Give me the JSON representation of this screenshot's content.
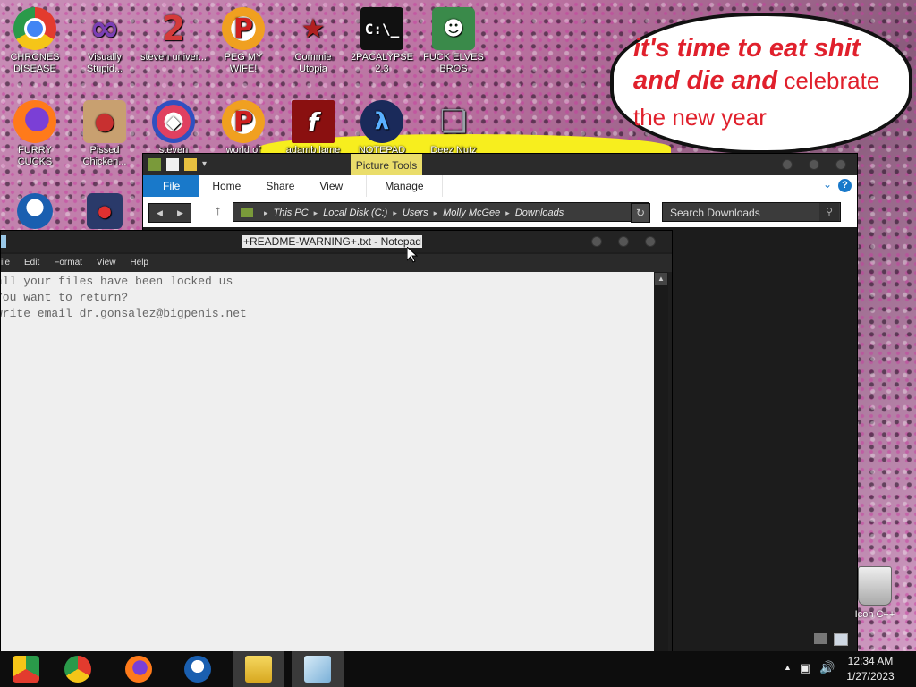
{
  "desktop": {
    "icons": [
      {
        "label": "CHRONES DISEASE",
        "icon": "chrome-icon",
        "color": "#e33b2e"
      },
      {
        "label": "Visually Stupid...",
        "icon": "visual-studio-icon",
        "color": "#7b3fb6"
      },
      {
        "label": "steven univer...",
        "icon": "steven-universe-icon",
        "color": "#d43a3a"
      },
      {
        "label": "PEG MY WIFE!",
        "icon": "peggle-icon",
        "color": "#f0a020"
      },
      {
        "label": "Commie Utopia",
        "icon": "commie-utopia-icon",
        "color": "#b02020"
      },
      {
        "label": "2PACALYPSE 2.3",
        "icon": "terminal-icon",
        "color": "#111111"
      },
      {
        "label": "FUCK ELVES BROS",
        "icon": "elf-icon",
        "color": "#3a8a4a"
      },
      {
        "label": "FURRY CUCKS",
        "icon": "firefox-icon",
        "color": "#ff7a1a"
      },
      {
        "label": "Pissed Chicken...",
        "icon": "angry-birds-seasons-icon",
        "color": "#c83030"
      },
      {
        "label": "steven",
        "icon": "gem-icon",
        "color": "#e04060"
      },
      {
        "label": "world of",
        "icon": "peggle-world-icon",
        "color": "#f0a020"
      },
      {
        "label": "adamb lame",
        "icon": "flash-icon",
        "color": "#8a1010"
      },
      {
        "label": "NOTEPAD",
        "icon": "notepad-plus-icon",
        "color": "#1a2a5a"
      },
      {
        "label": "Deez Nutz",
        "icon": "copy-icon",
        "color": "#9aa0a8"
      },
      {
        "label": "",
        "icon": "obama-logo-icon",
        "color": "#1a5fb0"
      },
      {
        "label": "",
        "icon": "angry-birds-space-icon",
        "color": "#2a3a6a"
      }
    ],
    "bubble_line1": "it's time to eat shit",
    "bubble_line2a": "and die and",
    "bubble_line2b": " celebrate",
    "bubble_line3": "the new year",
    "recycle_label": "Icon C++"
  },
  "explorer": {
    "contextual_tab": "Picture Tools",
    "tabs": [
      "File",
      "Home",
      "Share",
      "View",
      "Manage"
    ],
    "breadcrumb": [
      "This PC",
      "Local Disk (C:)",
      "Users",
      "Molly McGee",
      "Downloads"
    ],
    "search_placeholder": "Search Downloads"
  },
  "notepad": {
    "title": "+README-WARNING+.txt - Notepad",
    "menu": [
      "ile",
      "Edit",
      "Format",
      "View",
      "Help"
    ],
    "lines": [
      "all your files have been locked us",
      "You want to return?",
      "write email dr.gonsalez@bigpenis.net"
    ]
  },
  "taskbar": {
    "apps": [
      {
        "name": "chrome-alt-taskbar-icon",
        "color": "#2a9a4a"
      },
      {
        "name": "chrome-taskbar-icon",
        "color": "#e33b2e"
      },
      {
        "name": "firefox-taskbar-icon",
        "color": "#ff7a1a"
      },
      {
        "name": "obama-taskbar-icon",
        "color": "#1a5fb0"
      },
      {
        "name": "file-explorer-taskbar-icon",
        "color": "#e8c040"
      },
      {
        "name": "notepad-taskbar-icon",
        "color": "#9ac8e8"
      }
    ],
    "time": "12:34 AM",
    "date": "1/27/2023"
  }
}
